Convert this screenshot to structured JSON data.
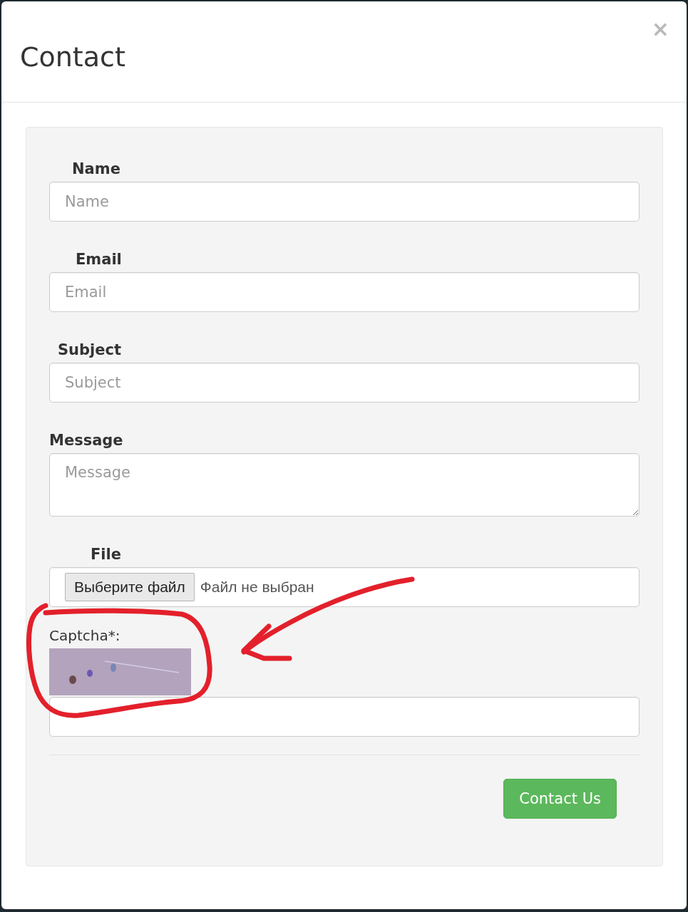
{
  "dialog": {
    "title": "Contact",
    "close": "×"
  },
  "fields": [
    {
      "kind": "text",
      "label": "Name",
      "placeholder": "Name"
    },
    {
      "kind": "text",
      "label": "Email",
      "placeholder": "Email"
    },
    {
      "kind": "text",
      "label": "Subject",
      "placeholder": "Subject"
    },
    {
      "kind": "textarea",
      "label": "Message",
      "placeholder": "Message"
    },
    {
      "kind": "file",
      "label": "File",
      "button": "Выберите файл",
      "status": "Файл не выбран"
    }
  ],
  "captcha": {
    "label": "Captcha*:",
    "highlighted": true
  },
  "submit": "Contact Us"
}
